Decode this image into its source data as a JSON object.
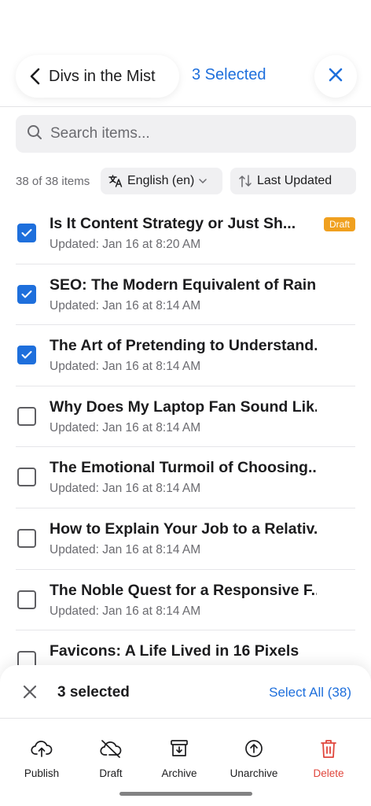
{
  "header": {
    "back_title": "Divs in the Mist",
    "selected_count": "3 Selected"
  },
  "search": {
    "placeholder": "Search items..."
  },
  "filters": {
    "count_text": "38 of 38 items",
    "language": "English (en)",
    "sort": "Last Updated"
  },
  "items": [
    {
      "title": "Is It Content Strategy or Just Sh...",
      "updated": "Updated: Jan 16 at 8:20 AM",
      "checked": true,
      "badge": "Draft"
    },
    {
      "title": "SEO: The Modern Equivalent of Rain...",
      "updated": "Updated: Jan 16 at 8:14 AM",
      "checked": true
    },
    {
      "title": "The Art of Pretending to Understand...",
      "updated": "Updated: Jan 16 at 8:14 AM",
      "checked": true
    },
    {
      "title": "Why Does My Laptop Fan Sound Lik...",
      "updated": "Updated: Jan 16 at 8:14 AM",
      "checked": false
    },
    {
      "title": "The Emotional Turmoil of Choosing...",
      "updated": "Updated: Jan 16 at 8:14 AM",
      "checked": false
    },
    {
      "title": "How to Explain Your Job to a Relativ...",
      "updated": "Updated: Jan 16 at 8:14 AM",
      "checked": false
    },
    {
      "title": "The Noble Quest for a Responsive F...",
      "updated": "Updated: Jan 16 at 8:14 AM",
      "checked": false
    },
    {
      "title": "Favicons: A Life Lived in 16 Pixels",
      "updated": "",
      "checked": false
    }
  ],
  "bottom_bar": {
    "selected_text": "3 selected",
    "select_all": "Select All (38)",
    "actions": [
      {
        "label": "Publish",
        "icon": "cloud-upload-icon"
      },
      {
        "label": "Draft",
        "icon": "cloud-off-icon"
      },
      {
        "label": "Archive",
        "icon": "archive-icon"
      },
      {
        "label": "Unarchive",
        "icon": "arrow-up-circle-icon"
      },
      {
        "label": "Delete",
        "icon": "trash-icon"
      }
    ]
  },
  "colors": {
    "accent": "#1e6fdc",
    "draft_badge": "#f0a01f",
    "delete": "#e0463c"
  }
}
